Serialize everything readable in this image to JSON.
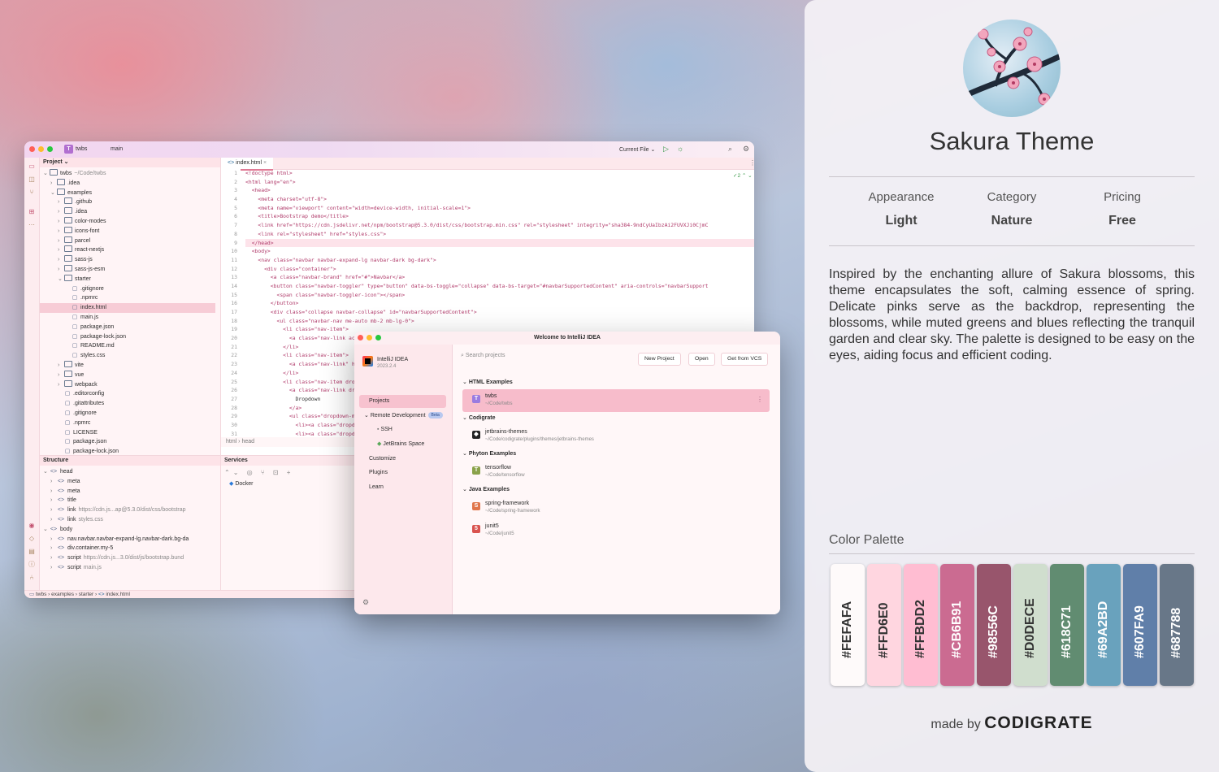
{
  "ide": {
    "project_name": "twbs",
    "branch": "main",
    "run_config": "Current File",
    "project_panel_title": "Project",
    "open_file_tab": "index.html",
    "tree": [
      {
        "label": "twbs",
        "hint": "~/Code/twbs",
        "depth": 0,
        "kind": "folder",
        "open": true
      },
      {
        "label": ".idea",
        "depth": 1,
        "kind": "folder"
      },
      {
        "label": "examples",
        "depth": 1,
        "kind": "folder",
        "open": true
      },
      {
        "label": ".github",
        "depth": 2,
        "kind": "folder"
      },
      {
        "label": ".idea",
        "depth": 2,
        "kind": "folder"
      },
      {
        "label": "color-modes",
        "depth": 2,
        "kind": "folder"
      },
      {
        "label": "icons-font",
        "depth": 2,
        "kind": "folder"
      },
      {
        "label": "parcel",
        "depth": 2,
        "kind": "folder"
      },
      {
        "label": "react-nextjs",
        "depth": 2,
        "kind": "folder"
      },
      {
        "label": "sass-js",
        "depth": 2,
        "kind": "folder"
      },
      {
        "label": "sass-js-esm",
        "depth": 2,
        "kind": "folder"
      },
      {
        "label": "starter",
        "depth": 2,
        "kind": "folder",
        "open": true
      },
      {
        "label": ".gitignore",
        "depth": 3,
        "kind": "file"
      },
      {
        "label": ".npmrc",
        "depth": 3,
        "kind": "file"
      },
      {
        "label": "index.html",
        "depth": 3,
        "kind": "file",
        "selected": true
      },
      {
        "label": "main.js",
        "depth": 3,
        "kind": "file"
      },
      {
        "label": "package.json",
        "depth": 3,
        "kind": "file"
      },
      {
        "label": "package-lock.json",
        "depth": 3,
        "kind": "file"
      },
      {
        "label": "README.md",
        "depth": 3,
        "kind": "file"
      },
      {
        "label": "styles.css",
        "depth": 3,
        "kind": "file"
      },
      {
        "label": "vite",
        "depth": 2,
        "kind": "folder"
      },
      {
        "label": "vue",
        "depth": 2,
        "kind": "folder"
      },
      {
        "label": "webpack",
        "depth": 2,
        "kind": "folder"
      },
      {
        "label": ".editorconfig",
        "depth": 2,
        "kind": "file"
      },
      {
        "label": ".gitattributes",
        "depth": 2,
        "kind": "file"
      },
      {
        "label": ".gitignore",
        "depth": 2,
        "kind": "file"
      },
      {
        "label": ".npmrc",
        "depth": 2,
        "kind": "file"
      },
      {
        "label": "LICENSE",
        "depth": 2,
        "kind": "file"
      },
      {
        "label": "package.json",
        "depth": 2,
        "kind": "file"
      },
      {
        "label": "package-lock.json",
        "depth": 2,
        "kind": "file"
      }
    ],
    "code_lines": [
      "<!doctype html>",
      "<html lang=\"en\">",
      "  <head>",
      "    <meta charset=\"utf-8\">",
      "    <meta name=\"viewport\" content=\"width=device-width, initial-scale=1\">",
      "    <title>Bootstrap demo</title>",
      "    <link href=\"https://cdn.jsdelivr.net/npm/bootstrap@5.3.0/dist/css/bootstrap.min.css\" rel=\"stylesheet\" integrity=\"sha384-9ndCyUaIbzAi2FUVXJi0CjmC",
      "    <link rel=\"stylesheet\" href=\"styles.css\">",
      "  </head>",
      "  <body>",
      "    <nav class=\"navbar navbar-expand-lg navbar-dark bg-dark\">",
      "      <div class=\"container\">",
      "        <a class=\"navbar-brand\" href=\"#\">Navbar</a>",
      "        <button class=\"navbar-toggler\" type=\"button\" data-bs-toggle=\"collapse\" data-bs-target=\"#navbarSupportedContent\" aria-controls=\"navbarSupport",
      "          <span class=\"navbar-toggler-icon\"></span>",
      "        </button>",
      "        <div class=\"collapse navbar-collapse\" id=\"navbarSupportedContent\">",
      "          <ul class=\"navbar-nav me-auto mb-2 mb-lg-0\">",
      "            <li class=\"nav-item\">",
      "              <a class=\"nav-link active",
      "            </li>",
      "            <li class=\"nav-item\">",
      "              <a class=\"nav-link\" href",
      "            </li>",
      "            <li class=\"nav-item dropdo",
      "              <a class=\"nav-link dropd",
      "                Dropdown",
      "              </a>",
      "              <ul class=\"dropdown-menu\"",
      "                <li><a class=\"dropdown-",
      "                <li><a class=\"dropdown-",
      "                <li><hr class=\"dropdow"
    ],
    "inspection_count": "2",
    "editor_breadcrumb": [
      "html",
      "head"
    ],
    "structure_title": "Structure",
    "structure": [
      {
        "label": "head",
        "depth": 0,
        "open": true
      },
      {
        "label": "meta",
        "depth": 1
      },
      {
        "label": "meta",
        "depth": 1
      },
      {
        "label": "title",
        "depth": 1
      },
      {
        "label": "link",
        "hint": "https://cdn.js...ap@5.3.0/dist/css/bootstrap",
        "depth": 1
      },
      {
        "label": "link",
        "hint": "styles.css",
        "depth": 1
      },
      {
        "label": "body",
        "depth": 0,
        "open": true
      },
      {
        "label": "nav.navbar.navbar-expand-lg.navbar-dark.bg-da",
        "depth": 1
      },
      {
        "label": "div.container.my-5",
        "depth": 1
      },
      {
        "label": "script",
        "hint": "https://cdn.js...3.0/dist/js/bootstrap.bund",
        "depth": 1
      },
      {
        "label": "script",
        "hint": "main.js",
        "depth": 1
      }
    ],
    "services_title": "Services",
    "services_item": "Docker",
    "status_path": [
      "twbs",
      "examples",
      "starter",
      "index.html"
    ]
  },
  "welcome": {
    "title": "Welcome to IntelliJ IDEA",
    "product": "IntelliJ IDEA",
    "version": "2023.2.4",
    "nav": [
      {
        "label": "Projects",
        "active": true
      },
      {
        "label": "Remote Development",
        "badge": "Beta"
      },
      {
        "label": "SSH",
        "sub": true
      },
      {
        "label": "JetBrains Space",
        "sub": true
      },
      {
        "label": "Customize"
      },
      {
        "label": "Plugins"
      },
      {
        "label": "Learn"
      }
    ],
    "search_placeholder": "Search projects",
    "buttons": [
      "New Project",
      "Open",
      "Get from VCS"
    ],
    "groups": [
      {
        "name": "HTML Examples",
        "projects": [
          {
            "letter": "T",
            "name": "twbs",
            "path": "~/Code/twbs",
            "color": "#9a7be0",
            "selected": true
          }
        ]
      },
      {
        "name": "Codigrate",
        "projects": [
          {
            "letter": "◆",
            "name": "jetbrains-themes",
            "path": "~/Code/codigrate/plugins/themes/jetbrains-themes",
            "color": "#222222"
          }
        ]
      },
      {
        "name": "Phyton Examples",
        "projects": [
          {
            "letter": "T",
            "name": "tensorflow",
            "path": "~/Code/tensorflow",
            "color": "#8aa24a"
          }
        ]
      },
      {
        "name": "Java Examples",
        "projects": [
          {
            "letter": "S",
            "name": "spring-framework",
            "path": "~/Code/spring-framework",
            "color": "#e0754a"
          },
          {
            "letter": "5",
            "name": "junit5",
            "path": "~/Code/junit5",
            "color": "#d9534f"
          }
        ]
      }
    ]
  },
  "info": {
    "title": "Sakura Theme",
    "meta": [
      {
        "label": "Appearance",
        "value": "Light"
      },
      {
        "label": "Category",
        "value": "Nature"
      },
      {
        "label": "Pricing",
        "value": "Free"
      }
    ],
    "description": "Inspired by the enchanting allure of Sakura blossoms, this theme encapsulates the soft, calming essence of spring. Delicate pinks serve as the backdrop, representing the blossoms, while muted greens and blues reflecting the tranquil garden and clear sky. The palette is designed to be easy on the eyes, aiding focus and efficient coding.",
    "palette_title": "Color Palette",
    "palette": [
      {
        "hex": "#FEFAFA",
        "text": "#333333"
      },
      {
        "hex": "#FFD6E0",
        "text": "#333333"
      },
      {
        "hex": "#FFBDD2",
        "text": "#333333"
      },
      {
        "hex": "#CB6B91",
        "text": "#ffffff"
      },
      {
        "hex": "#98556C",
        "text": "#ffffff"
      },
      {
        "hex": "#D0DECE",
        "text": "#333333"
      },
      {
        "hex": "#618C71",
        "text": "#ffffff"
      },
      {
        "hex": "#69A2BD",
        "text": "#ffffff"
      },
      {
        "hex": "#607FA9",
        "text": "#ffffff"
      },
      {
        "hex": "#687788",
        "text": "#ffffff"
      }
    ],
    "made_by": "made by",
    "brand": "CODIGRATE"
  }
}
